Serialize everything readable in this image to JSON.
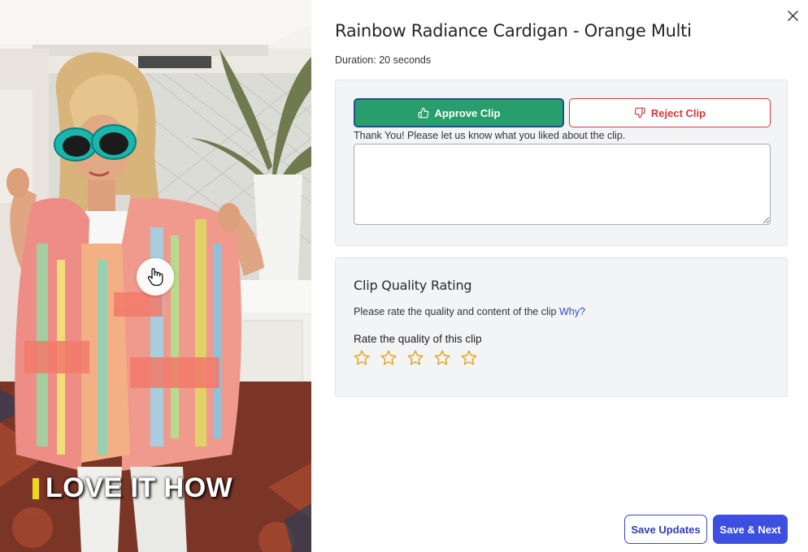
{
  "video": {
    "caption": "LOVE IT HOW"
  },
  "header": {
    "title": "Rainbow Radiance Cardigan - Orange Multi",
    "duration": "Duration: 20 seconds"
  },
  "approval": {
    "approve_label": "Approve Clip",
    "reject_label": "Reject Clip",
    "thanks_text": "Thank You! Please let us know what you liked about the clip.",
    "feedback_value": ""
  },
  "rating": {
    "title": "Clip Quality Rating",
    "description": "Please rate the quality and content of the clip",
    "why_link": "Why?",
    "rate_label": "Rate the quality of this clip",
    "stars_total": 5,
    "stars_selected": 0
  },
  "footer": {
    "save_updates_label": "Save Updates",
    "save_next_label": "Save & Next"
  },
  "colors": {
    "approve": "#279e6c",
    "reject": "#d03a3a",
    "primary": "#3d4fe0",
    "star": "#e8a317",
    "link": "#2b4fc7"
  }
}
